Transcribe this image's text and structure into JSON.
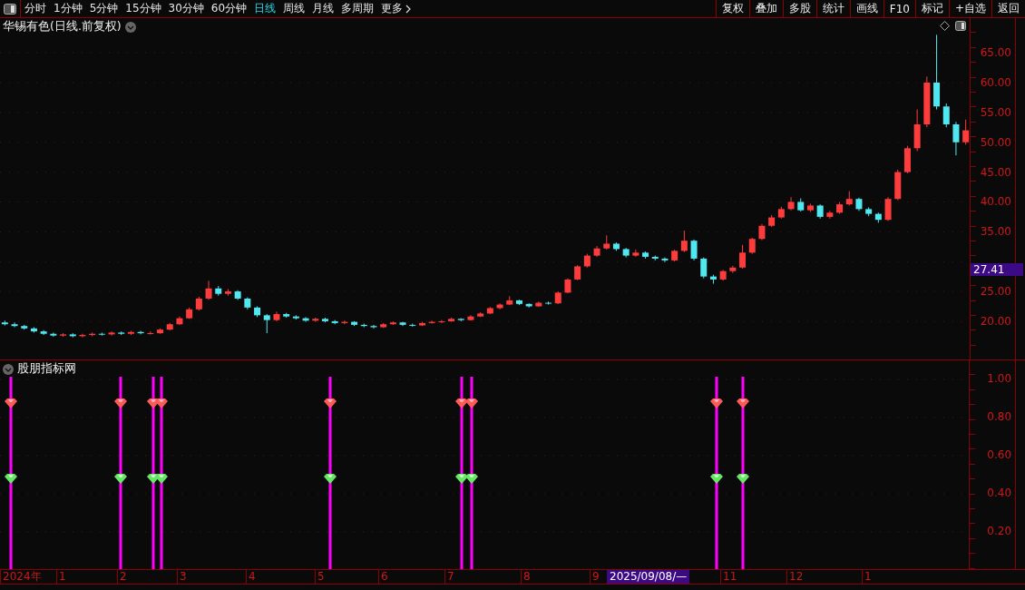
{
  "toolbar": {
    "periods": [
      {
        "label": "分时",
        "selected": false
      },
      {
        "label": "1分钟",
        "selected": false
      },
      {
        "label": "5分钟",
        "selected": false
      },
      {
        "label": "15分钟",
        "selected": false
      },
      {
        "label": "30分钟",
        "selected": false
      },
      {
        "label": "60分钟",
        "selected": false
      },
      {
        "label": "日线",
        "selected": true
      },
      {
        "label": "周线",
        "selected": false
      },
      {
        "label": "月线",
        "selected": false
      },
      {
        "label": "多周期",
        "selected": false
      }
    ],
    "more": "更多",
    "buttons": [
      "复权",
      "叠加",
      "多股",
      "统计",
      "画线",
      "F10",
      "标记",
      "+自选",
      "返回"
    ]
  },
  "main_chart": {
    "title": "华锡有色(日线.前复权)",
    "last_price": "27.41",
    "chart_data": {
      "type": "candlestick",
      "grid": true,
      "ylim": [
        13.6,
        70.8
      ],
      "categories": [
        null,
        null,
        null,
        null,
        null,
        null,
        null,
        null,
        null,
        null,
        null,
        null,
        null,
        null,
        null,
        null,
        null,
        null,
        null,
        null,
        null,
        null,
        null,
        null,
        null,
        null,
        null,
        null,
        null,
        null,
        null,
        null,
        null,
        null,
        null,
        null,
        null,
        null,
        null,
        null,
        null,
        null,
        null,
        null,
        null,
        null,
        null,
        null,
        null,
        null,
        null,
        null,
        null,
        null,
        null,
        null,
        null,
        null,
        null,
        null,
        null,
        null,
        null,
        null,
        null,
        null,
        null,
        null,
        null,
        null,
        null,
        null,
        null,
        null,
        null,
        null,
        null,
        null,
        null,
        null,
        null,
        null,
        null,
        null,
        null,
        null,
        null,
        null,
        null,
        null,
        null,
        null,
        null,
        null,
        null,
        null,
        null,
        null,
        null,
        null
      ],
      "yticks": [
        {
          "value": 65,
          "label": "65.00"
        },
        {
          "value": 60,
          "label": "60.00"
        },
        {
          "value": 55,
          "label": "55.00"
        },
        {
          "value": 50,
          "label": "50.00"
        },
        {
          "value": 45,
          "label": "45.00"
        },
        {
          "value": 40,
          "label": "40.00"
        },
        {
          "value": 35,
          "label": "35.00"
        },
        {
          "value": 25,
          "label": "25.00"
        },
        {
          "value": 20,
          "label": "20.00"
        }
      ],
      "ohlc": [
        [
          19.8,
          20.1,
          19.3,
          19.5
        ],
        [
          19.5,
          19.8,
          19.0,
          19.2
        ],
        [
          19.2,
          19.4,
          18.6,
          18.8
        ],
        [
          18.8,
          19.0,
          18.1,
          18.3
        ],
        [
          18.3,
          18.5,
          17.7,
          17.9
        ],
        [
          17.9,
          18.1,
          17.4,
          17.6
        ],
        [
          17.6,
          18.0,
          17.4,
          17.8
        ],
        [
          17.8,
          18.0,
          17.3,
          17.5
        ],
        [
          17.5,
          17.9,
          17.3,
          17.7
        ],
        [
          17.7,
          18.1,
          17.5,
          17.9
        ],
        [
          17.9,
          18.1,
          17.6,
          17.8
        ],
        [
          17.8,
          18.3,
          17.6,
          18.1
        ],
        [
          18.1,
          18.3,
          17.7,
          17.9
        ],
        [
          17.9,
          18.4,
          17.7,
          18.2
        ],
        [
          18.2,
          18.4,
          17.8,
          18.0
        ],
        [
          18.0,
          18.3,
          17.8,
          18.0
        ],
        [
          18.0,
          18.8,
          17.9,
          18.6
        ],
        [
          18.6,
          19.7,
          18.5,
          19.5
        ],
        [
          19.5,
          20.8,
          19.4,
          20.5
        ],
        [
          20.5,
          22.3,
          20.4,
          22.0
        ],
        [
          22.0,
          24.1,
          21.8,
          23.8
        ],
        [
          23.8,
          26.8,
          23.6,
          25.5
        ],
        [
          25.5,
          25.9,
          24.3,
          24.6
        ],
        [
          24.6,
          25.4,
          24.3,
          25.0
        ],
        [
          25.0,
          25.2,
          23.6,
          23.8
        ],
        [
          23.8,
          24.0,
          22.0,
          22.3
        ],
        [
          22.3,
          22.5,
          20.7,
          21.0
        ],
        [
          21.0,
          21.2,
          18.0,
          20.2
        ],
        [
          20.2,
          21.6,
          20.0,
          21.2
        ],
        [
          21.2,
          21.4,
          20.6,
          20.8
        ],
        [
          20.8,
          21.0,
          20.3,
          20.5
        ],
        [
          20.5,
          20.7,
          19.9,
          20.1
        ],
        [
          20.1,
          20.6,
          19.9,
          20.4
        ],
        [
          20.4,
          20.6,
          19.8,
          20.0
        ],
        [
          20.0,
          20.2,
          19.5,
          19.7
        ],
        [
          19.7,
          20.1,
          19.5,
          19.9
        ],
        [
          19.9,
          20.0,
          19.2,
          19.4
        ],
        [
          19.4,
          19.6,
          19.0,
          19.2
        ],
        [
          19.2,
          19.4,
          18.8,
          19.0
        ],
        [
          19.0,
          19.7,
          18.9,
          19.5
        ],
        [
          19.5,
          20.0,
          19.4,
          19.8
        ],
        [
          19.8,
          19.9,
          19.2,
          19.4
        ],
        [
          19.4,
          19.6,
          19.1,
          19.3
        ],
        [
          19.3,
          19.9,
          19.2,
          19.7
        ],
        [
          19.7,
          20.1,
          19.6,
          19.9
        ],
        [
          19.9,
          20.2,
          19.7,
          20.0
        ],
        [
          20.0,
          20.6,
          19.9,
          20.4
        ],
        [
          20.4,
          20.5,
          20.0,
          20.2
        ],
        [
          20.2,
          21.0,
          20.1,
          20.8
        ],
        [
          20.8,
          21.5,
          20.7,
          21.3
        ],
        [
          21.3,
          22.4,
          21.2,
          22.2
        ],
        [
          22.2,
          23.0,
          22.0,
          22.8
        ],
        [
          22.8,
          24.2,
          22.7,
          23.5
        ],
        [
          23.5,
          23.6,
          22.7,
          22.9
        ],
        [
          22.9,
          23.0,
          22.3,
          22.5
        ],
        [
          22.5,
          23.3,
          22.4,
          23.1
        ],
        [
          23.1,
          23.3,
          22.8,
          23.0
        ],
        [
          23.0,
          25.0,
          22.9,
          24.8
        ],
        [
          24.8,
          27.2,
          24.7,
          27.0
        ],
        [
          27.0,
          29.4,
          26.9,
          29.2
        ],
        [
          29.2,
          31.3,
          29.0,
          31.0
        ],
        [
          31.0,
          32.6,
          30.8,
          32.2
        ],
        [
          32.2,
          34.4,
          32.0,
          33.0
        ],
        [
          33.0,
          33.2,
          31.8,
          32.1
        ],
        [
          32.1,
          32.3,
          30.7,
          31.0
        ],
        [
          31.0,
          32.0,
          30.8,
          31.5
        ],
        [
          31.5,
          31.7,
          30.5,
          30.8
        ],
        [
          30.8,
          31.0,
          30.2,
          30.5
        ],
        [
          30.5,
          30.7,
          29.9,
          30.2
        ],
        [
          30.2,
          32.0,
          30.0,
          31.8
        ],
        [
          31.8,
          35.2,
          31.6,
          33.5
        ],
        [
          33.5,
          33.7,
          30.2,
          30.5
        ],
        [
          30.5,
          30.7,
          27.2,
          27.5
        ],
        [
          27.5,
          27.8,
          26.3,
          27.0
        ],
        [
          27.0,
          28.6,
          26.8,
          28.4
        ],
        [
          28.4,
          29.3,
          28.1,
          29.0
        ],
        [
          29.0,
          32.8,
          28.8,
          31.5
        ],
        [
          31.5,
          34.0,
          31.3,
          33.8
        ],
        [
          33.8,
          36.3,
          33.6,
          36.0
        ],
        [
          36.0,
          37.8,
          35.8,
          37.4
        ],
        [
          37.4,
          39.2,
          37.2,
          38.8
        ],
        [
          38.8,
          40.8,
          38.6,
          40.0
        ],
        [
          40.0,
          40.6,
          38.4,
          38.6
        ],
        [
          38.6,
          39.7,
          38.3,
          39.4
        ],
        [
          39.4,
          39.6,
          37.2,
          37.5
        ],
        [
          37.5,
          38.5,
          37.2,
          38.2
        ],
        [
          38.2,
          40.0,
          38.0,
          39.6
        ],
        [
          39.6,
          41.8,
          39.4,
          40.5
        ],
        [
          40.5,
          40.7,
          38.5,
          38.8
        ],
        [
          38.8,
          39.1,
          37.6,
          38.0
        ],
        [
          38.0,
          38.2,
          36.5,
          37.0
        ],
        [
          37.0,
          40.8,
          36.8,
          40.5
        ],
        [
          40.5,
          45.4,
          40.3,
          45.0
        ],
        [
          45.0,
          49.4,
          44.8,
          49.0
        ],
        [
          49.0,
          55.5,
          48.5,
          53.0
        ],
        [
          53.0,
          61.0,
          52.5,
          60.0
        ],
        [
          60.0,
          68.0,
          55.5,
          56.0
        ],
        [
          56.0,
          56.5,
          52.5,
          53.0
        ],
        [
          53.0,
          53.4,
          47.8,
          50.0
        ],
        [
          50.0,
          53.8,
          49.6,
          52.0
        ]
      ]
    }
  },
  "indicator": {
    "title": "股朋指标网",
    "y_ticks": [
      "1.00",
      "0.80",
      "0.60",
      "0.40",
      "0.20"
    ]
  },
  "x_axis": {
    "labels": [
      "2024年",
      "1",
      "2",
      "3",
      "4",
      "5",
      "6",
      "7",
      "8",
      "9",
      "11",
      "12",
      "1"
    ],
    "cursor_date": "2025/09/08/—"
  }
}
